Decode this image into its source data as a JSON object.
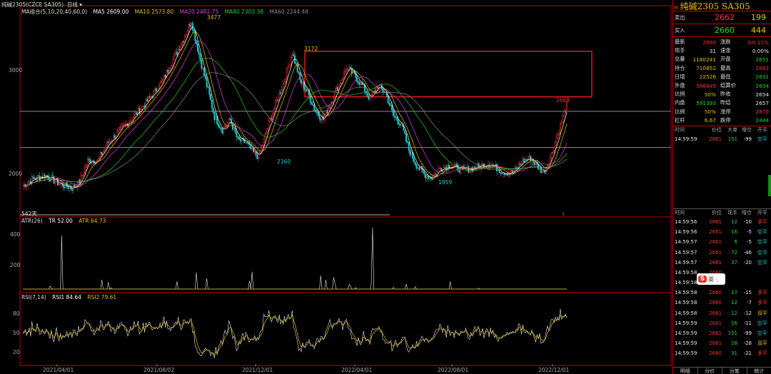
{
  "header": {
    "symbol": "纯碱2305",
    "code_period": "CZCE SA305",
    "period": "日线"
  },
  "ma": {
    "label": "MA组合(5,10,20,40,60,0)",
    "ma5": "MA5 2609.00",
    "ma10": "MA10 2573.80",
    "ma20": "MA20 2482.75",
    "ma40": "MA40 2303.38",
    "ma60": "MA60 2244.48",
    "ma5_color": "#ffffff",
    "ma10_color": "#e8c000",
    "ma20_color": "#e040e0",
    "ma40_color": "#20d020",
    "ma60_color": "#888888"
  },
  "chart_data": [
    {
      "type": "line",
      "title": "纯碱2305 日线",
      "x": [
        "2021/04/01",
        "2021/08/02",
        "2021/12/01",
        "2022/04/01",
        "2022/08/01",
        "2022/12/01"
      ],
      "ylim": [
        1700,
        3500
      ],
      "y_ticks": [
        "3000",
        "2000"
      ],
      "annotations": [
        "3477",
        "3172",
        "2160",
        "1959",
        "2663",
        "542天"
      ],
      "horizontal_lines": [
        2600,
        2250
      ],
      "highlight_box": {
        "y_range": [
          2740,
          3180
        ]
      }
    },
    {
      "type": "line",
      "title": "ATR(26)",
      "series": [
        {
          "name": "TR",
          "last": 52.0
        },
        {
          "name": "ATR",
          "last": 64.73
        }
      ],
      "y_ticks": [
        "400",
        "200"
      ]
    },
    {
      "type": "line",
      "title": "RSI(7,14)",
      "series": [
        {
          "name": "RSI1",
          "last": 84.64
        },
        {
          "name": "RSI2",
          "last": 79.61
        }
      ],
      "y_ticks": [
        "80",
        "50",
        "20"
      ]
    }
  ],
  "atr": {
    "label": "ATR(26)",
    "tr": "TR 52.00",
    "atr": "ATR 64.73"
  },
  "rsi": {
    "label": "RSI(7,14)",
    "rsi1": "RSI1 84.64",
    "rsi2": "RSI2 79.61"
  },
  "axis": {
    "y3000": "3000",
    "y2000": "2000",
    "atr400": "400",
    "atr200": "200",
    "rsi80": "80",
    "rsi50": "50",
    "rsi20": "20",
    "dates": [
      "2021/04/01",
      "2021/08/02",
      "2021/12/01",
      "2022/04/01",
      "2022/08/01",
      "2022/12/01"
    ]
  },
  "marks": {
    "high": "3477",
    "box_high": "3172",
    "low1": "2160",
    "low2": "1959",
    "last": "2663",
    "days": "542天"
  },
  "panel": {
    "title": "纯碱2305  SA305",
    "ask_label": "卖出",
    "ask_price": "2662",
    "ask_vol": "199",
    "bid_label": "买入",
    "bid_price": "2660",
    "bid_vol": "444",
    "stats": [
      {
        "l1": "最新",
        "v1": "2660",
        "c1": "r",
        "l2": "涨跌",
        "v2": "3/0.11%",
        "c2": "r"
      },
      {
        "l1": "现手",
        "v1": "31",
        "c1": "w",
        "l2": "速涨",
        "v2": "0.00%",
        "c2": "w"
      },
      {
        "l1": "总量",
        "v1": "1180241",
        "c1": "y",
        "l2": "开盘",
        "v2": "2651",
        "c2": "g"
      },
      {
        "l1": "持仓",
        "v1": "710852",
        "c1": "y",
        "l2": "最高",
        "v2": "2683",
        "c2": "r"
      },
      {
        "l1": "日增",
        "v1": "22526",
        "c1": "y",
        "l2": "最低",
        "v2": "2631",
        "c2": "g"
      },
      {
        "l1": "外盘",
        "v1": "588849",
        "c1": "r",
        "l2": "结算价",
        "v2": "2654",
        "c2": "g"
      },
      {
        "l1": "比例",
        "v1": "50%",
        "c1": "y",
        "l2": "昨收",
        "v2": "2654",
        "c2": "w"
      },
      {
        "l1": "内盘",
        "v1": "591393",
        "c1": "g",
        "l2": "昨结",
        "v2": "2657",
        "c2": "w"
      },
      {
        "l1": "比例",
        "v1": "50%",
        "c1": "y",
        "l2": "涨停",
        "v2": "2870",
        "c2": "r"
      },
      {
        "l1": "杠杆",
        "v1": "6.67",
        "c1": "y",
        "l2": "跌停",
        "v2": "2444",
        "c2": "g"
      }
    ],
    "tick_header": {
      "time": "时间",
      "price": "价位",
      "vol": "大单",
      "oi": "增仓",
      "type": "开平"
    },
    "big_ticks": [
      {
        "time": "14:59:59",
        "price": "2661",
        "vol": "151",
        "oi": "-99",
        "type": "空平",
        "tc": "c"
      }
    ],
    "tick_header2": {
      "time": "时间",
      "price": "价位",
      "vol": "现手",
      "oi": "增仓",
      "type": "开平"
    },
    "ticks": [
      {
        "time": "14:59:56",
        "price": "2661",
        "vol": "12",
        "oi": "-10",
        "type": "多平",
        "tc": "r"
      },
      {
        "time": "14:59:56",
        "price": "2661",
        "vol": "16",
        "oi": "-5",
        "type": "空平",
        "tc": "c"
      },
      {
        "time": "14:59:57",
        "price": "2661",
        "vol": "6",
        "oi": "-5",
        "type": "空平",
        "tc": "c"
      },
      {
        "time": "14:59:57",
        "price": "2661",
        "vol": "72",
        "oi": "-46",
        "type": "空平",
        "tc": "c"
      },
      {
        "time": "14:59:57",
        "price": "2661",
        "vol": "37",
        "oi": "-20",
        "type": "空平",
        "tc": "c"
      },
      {
        "time": "14:59:58",
        "price": "2660",
        "vol": "",
        "oi": "",
        "type": "",
        "tc": "c"
      },
      {
        "time": "14:59:58",
        "price": "2660",
        "vol": "",
        "oi": "",
        "type": "",
        "tc": "c"
      },
      {
        "time": "14:59:58",
        "price": "2660",
        "vol": "17",
        "oi": "-15",
        "type": "多平",
        "tc": "r"
      },
      {
        "time": "14:59:58",
        "price": "2660",
        "vol": "12",
        "oi": "-7",
        "type": "多平",
        "tc": "r"
      },
      {
        "time": "14:59:58",
        "price": "2661",
        "vol": "12",
        "oi": "-12",
        "type": "双平",
        "tc": "y"
      },
      {
        "time": "14:59:59",
        "price": "2661",
        "vol": "16",
        "oi": "-11",
        "type": "空平",
        "tc": "c"
      },
      {
        "time": "14:59:59",
        "price": "2661",
        "vol": "151",
        "oi": "-99",
        "type": "空平",
        "tc": "c"
      },
      {
        "time": "14:59:59",
        "price": "2661",
        "vol": "28",
        "oi": "-28",
        "type": "双平",
        "tc": "y"
      },
      {
        "time": "14:59:59",
        "price": "2660",
        "vol": "31",
        "oi": "-21",
        "type": "多平",
        "tc": "r"
      }
    ],
    "tabs": [
      "明细",
      "分价",
      "分笔",
      "统计"
    ],
    "ime": "英"
  }
}
